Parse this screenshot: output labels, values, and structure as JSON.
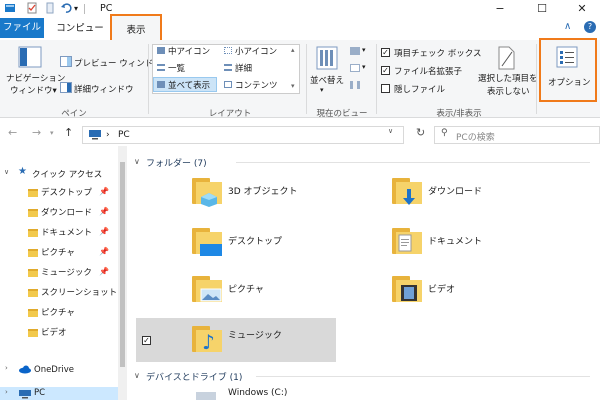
{
  "window": {
    "title": "PC",
    "controls": {
      "minimize": "−",
      "maximize": "☐",
      "close": "✕"
    }
  },
  "ribbon": {
    "tabs": {
      "file": "ファイル",
      "computer": "コンピューター",
      "view": "表示"
    },
    "collapse_glyph": "∧",
    "help_glyph": "?",
    "groups": {
      "pane": {
        "label": "ペイン",
        "nav_pane_line1": "ナビゲーション",
        "nav_pane_line2": "ウィンドウ▾",
        "preview": "プレビュー ウィンドウ",
        "details": "詳細ウィンドウ"
      },
      "layout": {
        "label": "レイアウト",
        "medium_icons": "中アイコン",
        "small_icons": "小アイコン",
        "list": "一覧",
        "details": "詳細",
        "tiles": "並べて表示",
        "content": "コンテンツ"
      },
      "current_view": {
        "label": "現在のビュー",
        "sort_by": "並べ替え",
        "sort_caret": "▾"
      },
      "show_hide": {
        "label": "表示/非表示",
        "item_checkboxes": "項目チェック ボックス",
        "item_checkboxes_checked": true,
        "file_extensions": "ファイル名拡張子",
        "file_extensions_checked": true,
        "hidden_items": "隠しファイル",
        "hidden_items_checked": false,
        "hide_selected_line1": "選択した項目を",
        "hide_selected_line2": "表示しない"
      },
      "options": {
        "label": "オプション"
      }
    }
  },
  "address": {
    "path": "PC",
    "separator": "›",
    "search_placeholder": "PCの検索"
  },
  "navigation_pane": {
    "quick_access": "クイック アクセス",
    "items": [
      {
        "label": "デスクトップ",
        "pinned": true
      },
      {
        "label": "ダウンロード",
        "pinned": true
      },
      {
        "label": "ドキュメント",
        "pinned": true
      },
      {
        "label": "ピクチャ",
        "pinned": true
      },
      {
        "label": "ミュージック",
        "pinned": true
      },
      {
        "label": "スクリーンショット",
        "pinned": false
      },
      {
        "label": "ピクチャ",
        "pinned": false
      },
      {
        "label": "ビデオ",
        "pinned": false
      }
    ],
    "onedrive": "OneDrive",
    "pc": "PC"
  },
  "content": {
    "folders_header": "フォルダー (7)",
    "folders": [
      "3D オブジェクト",
      "ダウンロード",
      "デスクトップ",
      "ドキュメント",
      "ピクチャ",
      "ビデオ",
      "ミュージック"
    ],
    "drives_header": "デバイスとドライブ (1)",
    "drives": [
      "Windows (C:)"
    ]
  },
  "colors": {
    "accent_orange": "#f07a1a",
    "file_tab_blue": "#1979ca",
    "folder_yellow": "#f6d36a"
  }
}
